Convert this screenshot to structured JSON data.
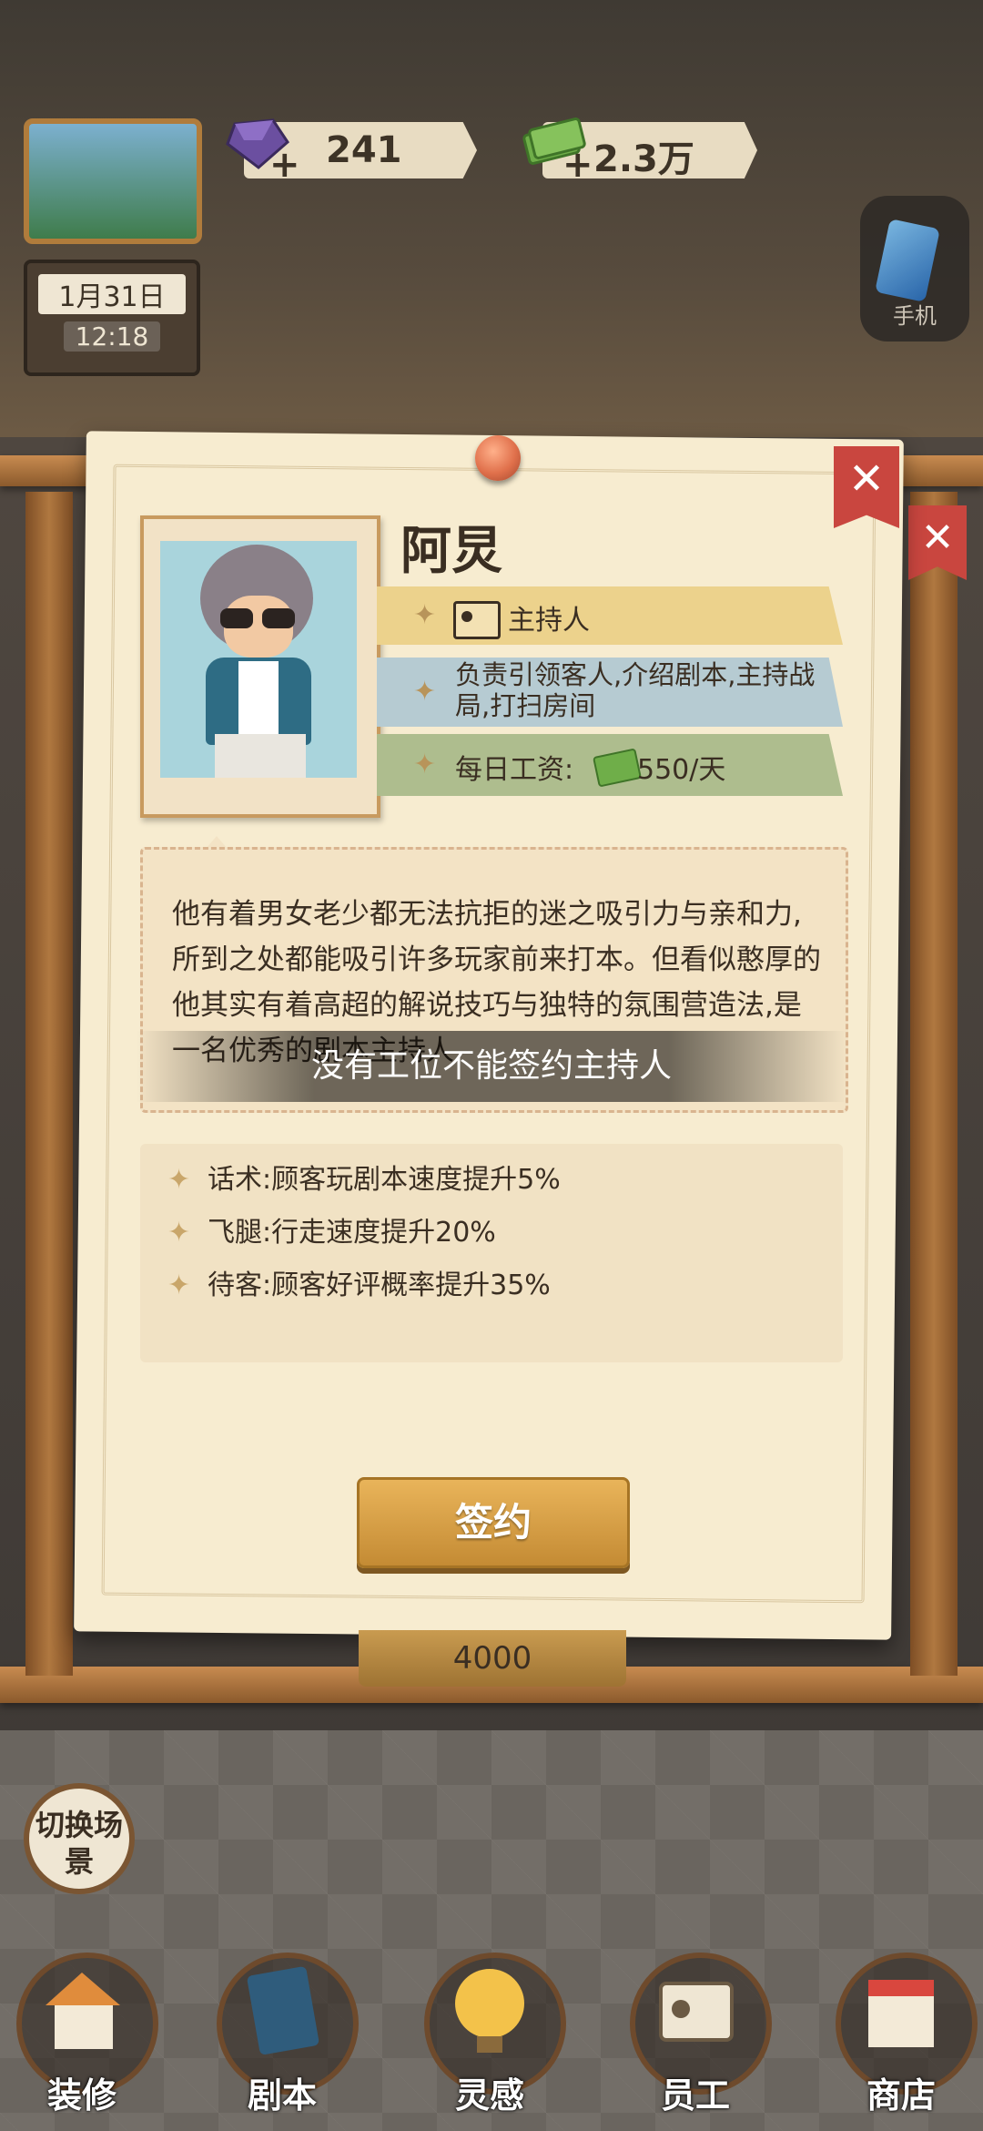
{
  "hud": {
    "gems": "241",
    "cash": "2.3万",
    "date": "1月31日",
    "time": "12:18",
    "phone_label": "手机"
  },
  "card": {
    "name": "阿炅",
    "role": "主持人",
    "duty": "负责引领客人,介绍剧本,主持战局,打扫房间",
    "salary_label": "每日工资:",
    "salary_value": "550/天",
    "description": "他有着男女老少都无法抗拒的迷之吸引力与亲和力,所到之处都能吸引许多玩家前来打本。但看似憨厚的他其实有着高超的解说技巧与独特的氛围营造法,是一名优秀的剧本主持人",
    "toast": "没有工位不能签约主持人",
    "skills": [
      "话术:顾客玩剧本速度提升5%",
      "飞腿:行走速度提升20%",
      "待客:顾客好评概率提升35%"
    ],
    "sign_label": "签约",
    "cost_peek": "4000",
    "close_glyph": "✕"
  },
  "bottom": {
    "switch_label": "切换场景",
    "nav": [
      "装修",
      "剧本",
      "灵感",
      "员工",
      "商店"
    ]
  }
}
